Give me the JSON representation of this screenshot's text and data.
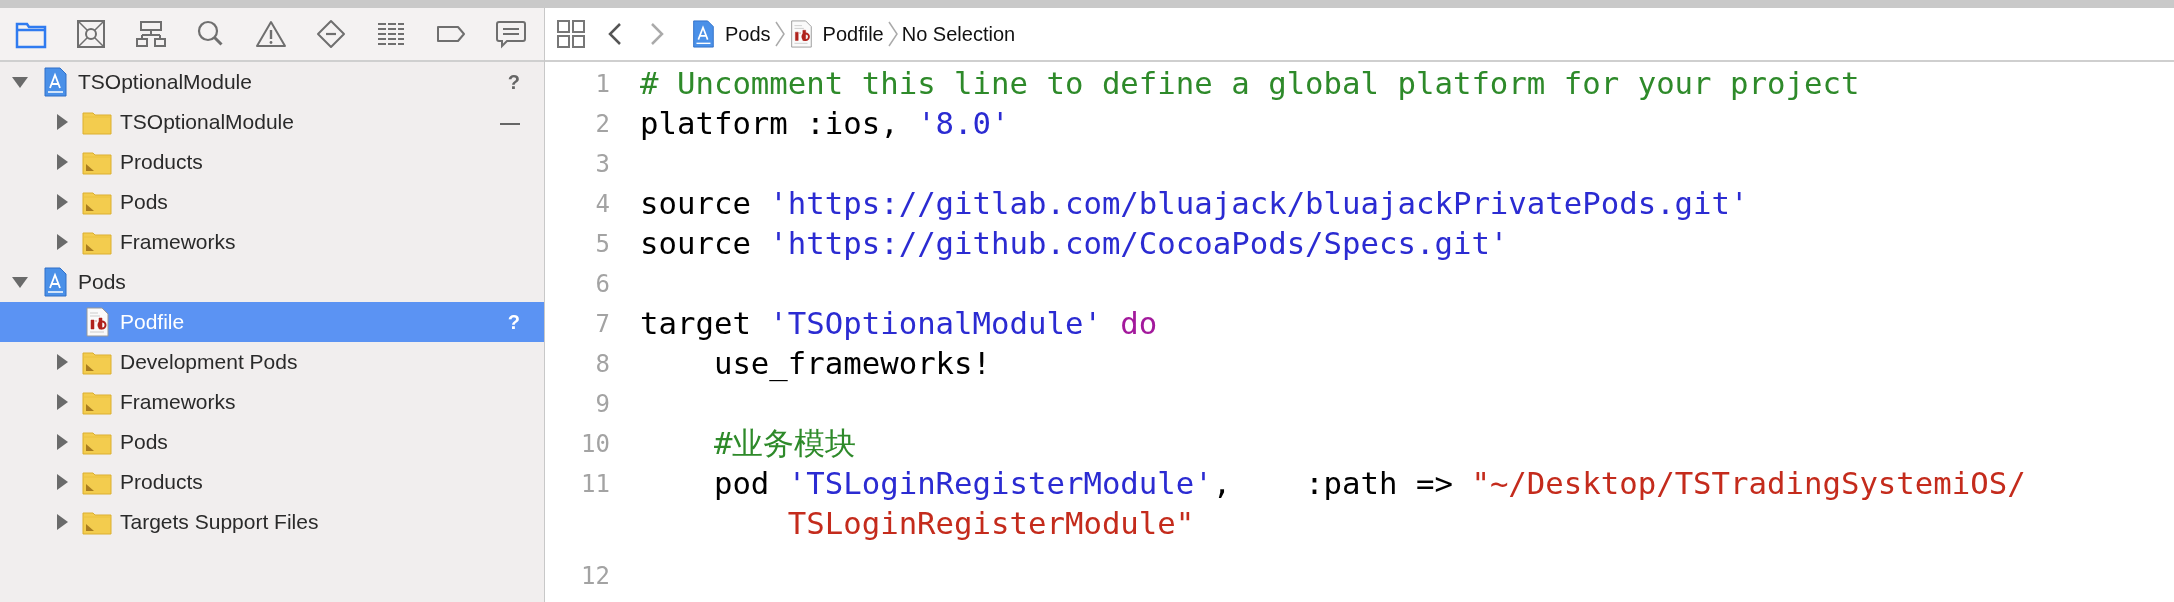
{
  "navigator_tabs": [
    {
      "kind": "folder",
      "selected": true
    },
    {
      "kind": "source_control",
      "selected": false
    },
    {
      "kind": "hierarchy",
      "selected": false
    },
    {
      "kind": "search",
      "selected": false
    },
    {
      "kind": "warning",
      "selected": false
    },
    {
      "kind": "test",
      "selected": false
    },
    {
      "kind": "debug",
      "selected": false
    },
    {
      "kind": "breakpoint",
      "selected": false
    },
    {
      "kind": "report",
      "selected": false
    }
  ],
  "tree": [
    {
      "label": "TSOptionalModule",
      "kind": "project",
      "expanded": true,
      "badge": "?",
      "selected": false,
      "children": [
        {
          "label": "TSOptionalModule",
          "kind": "folder",
          "expanded": false,
          "badge": "—",
          "selected": false
        },
        {
          "label": "Products",
          "kind": "group",
          "expanded": false,
          "selected": false
        },
        {
          "label": "Pods",
          "kind": "group",
          "expanded": false,
          "selected": false
        },
        {
          "label": "Frameworks",
          "kind": "group",
          "expanded": false,
          "selected": false
        }
      ]
    },
    {
      "label": "Pods",
      "kind": "project",
      "expanded": true,
      "selected": false,
      "children": [
        {
          "label": "Podfile",
          "kind": "ruby",
          "badge": "?",
          "selected": true
        },
        {
          "label": "Development Pods",
          "kind": "group",
          "expanded": false,
          "selected": false
        },
        {
          "label": "Frameworks",
          "kind": "group",
          "expanded": false,
          "selected": false
        },
        {
          "label": "Pods",
          "kind": "group",
          "expanded": false,
          "selected": false
        },
        {
          "label": "Products",
          "kind": "group",
          "expanded": false,
          "selected": false
        },
        {
          "label": "Targets Support Files",
          "kind": "group",
          "expanded": false,
          "selected": false
        }
      ]
    }
  ],
  "breadcrumbs": [
    {
      "label": "Pods",
      "kind": "project"
    },
    {
      "label": "Podfile",
      "kind": "ruby"
    },
    {
      "label": "No Selection"
    }
  ],
  "code_lines": [
    {
      "number": "1",
      "tokens": [
        {
          "kind": "comment",
          "text": "# Uncomment this line to define a global platform for your project"
        }
      ]
    },
    {
      "number": "2",
      "tokens": [
        {
          "kind": "plain",
          "text": "platform :ios, "
        },
        {
          "kind": "string",
          "text": "'8.0'"
        }
      ]
    },
    {
      "number": "3"
    },
    {
      "number": "4",
      "tokens": [
        {
          "kind": "plain",
          "text": "source "
        },
        {
          "kind": "string",
          "text": "'https://gitlab.com/bluajack/bluajackPrivatePods.git'"
        }
      ]
    },
    {
      "number": "5",
      "tokens": [
        {
          "kind": "plain",
          "text": "source "
        },
        {
          "kind": "string",
          "text": "'https://github.com/CocoaPods/Specs.git'"
        }
      ]
    },
    {
      "number": "6"
    },
    {
      "number": "7",
      "tokens": [
        {
          "kind": "plain",
          "text": "target "
        },
        {
          "kind": "string",
          "text": "'TSOptionalModule'"
        },
        {
          "kind": "keyword",
          "text": " do"
        }
      ]
    },
    {
      "number": "8",
      "tokens": [
        {
          "kind": "plain",
          "text": "    use_frameworks!"
        }
      ]
    },
    {
      "number": "9"
    },
    {
      "number": "10",
      "tokens": [
        {
          "kind": "comment",
          "text": "    #业务模块"
        }
      ]
    },
    {
      "number": "11",
      "tokens": [
        {
          "kind": "plain",
          "text": "    pod "
        },
        {
          "kind": "string",
          "text": "'TSLoginRegisterModule'"
        },
        {
          "kind": "plain",
          "text": ",    :path => "
        },
        {
          "kind": "path",
          "text": "\"~/Desktop/TSTradingSystemiOS/TSLoginRegisterModule\""
        }
      ]
    },
    {
      "number": "12"
    }
  ]
}
